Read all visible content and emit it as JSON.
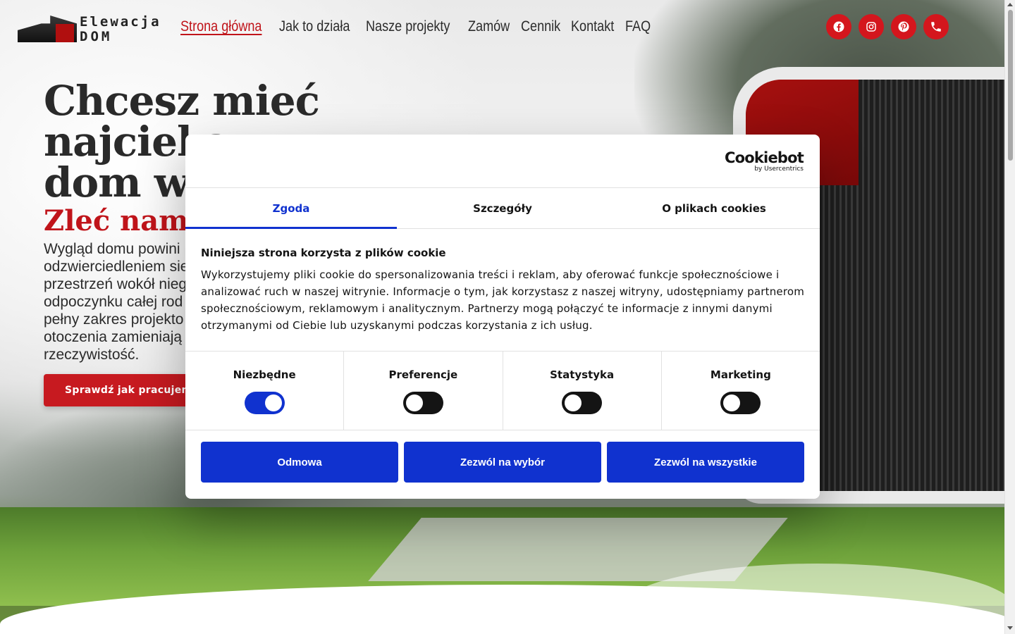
{
  "colors": {
    "brand_red": "#c0141a",
    "consent_blue": "#1032cf",
    "text_dark": "#141414"
  },
  "logo": {
    "line1": "Elewacja",
    "line2": "DOM"
  },
  "nav": {
    "items": [
      {
        "label": "Strona główna",
        "active": true
      },
      {
        "label": "Jak to działa",
        "active": false
      },
      {
        "label": "Nasze projekty",
        "active": false
      },
      {
        "label": "Zamów",
        "active": false
      },
      {
        "label": "Cennik",
        "active": false
      },
      {
        "label": "Kontakt",
        "active": false
      },
      {
        "label": "FAQ",
        "active": false
      }
    ]
  },
  "social": {
    "icons": [
      "facebook-icon",
      "instagram-icon",
      "pinterest-icon",
      "phone-icon"
    ]
  },
  "hero": {
    "title_line1": "Chcesz mieć",
    "title_line2": "najcieka",
    "title_line3": "dom w",
    "subtitle": "Zleć nam p",
    "desc_lines": [
      "Wygląd domu powini",
      "odzwierciedleniem sie",
      "przestrzeń wokół nieg",
      "odpoczynku całej rod",
      "pełny zakres projekto",
      "otoczenia zamieniają",
      "rzeczywistość."
    ],
    "cta_label": "Sprawdź jak pracujemy"
  },
  "cookie": {
    "brand": "Cookiebot",
    "brand_by": "by Usercentrics",
    "tabs": [
      {
        "label": "Zgoda",
        "active": true
      },
      {
        "label": "Szczegóły",
        "active": false
      },
      {
        "label": "O plikach cookies",
        "active": false
      }
    ],
    "heading": "Niniejsza strona korzysta z plików cookie",
    "body": "Wykorzystujemy pliki cookie do spersonalizowania treści i reklam, aby oferować funkcje społecznościowe i analizować ruch w naszej witrynie. Informacje o tym, jak korzystasz z naszej witryny, udostępniamy partnerom społecznościowym, reklamowym i analitycznym. Partnerzy mogą połączyć te informacje z innymi danymi otrzymanymi od Ciebie lub uzyskanymi podczas korzystania z ich usług.",
    "categories": [
      {
        "label": "Niezbędne",
        "enabled": true
      },
      {
        "label": "Preferencje",
        "enabled": false
      },
      {
        "label": "Statystyka",
        "enabled": false
      },
      {
        "label": "Marketing",
        "enabled": false
      }
    ],
    "buttons": {
      "deny": "Odmowa",
      "allow_selection": "Zezwól na wybór",
      "allow_all": "Zezwól na wszystkie"
    }
  }
}
